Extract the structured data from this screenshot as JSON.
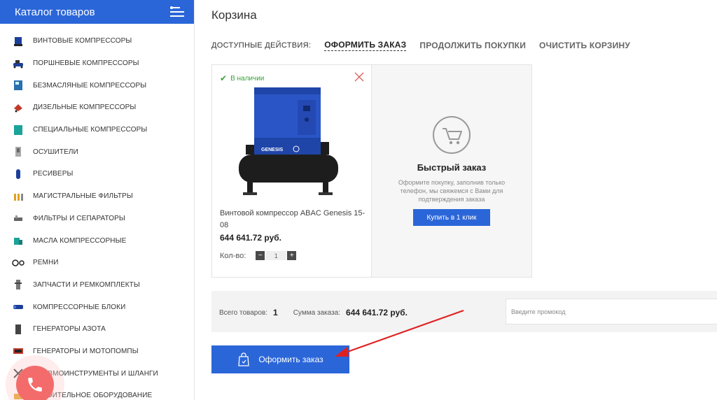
{
  "sidebar": {
    "title": "Каталог товаров",
    "items": [
      {
        "label": "ВИНТОВЫЕ КОМПРЕССОРЫ",
        "icon": "screw-compressor-icon"
      },
      {
        "label": "ПОРШНЕВЫЕ КОМПРЕССОРЫ",
        "icon": "piston-compressor-icon"
      },
      {
        "label": "БЕЗМАСЛЯНЫЕ КОМПРЕССОРЫ",
        "icon": "oilfree-compressor-icon"
      },
      {
        "label": "ДИЗЕЛЬНЫЕ КОМПРЕССОРЫ",
        "icon": "diesel-compressor-icon"
      },
      {
        "label": "СПЕЦИАЛЬНЫЕ КОМПРЕССОРЫ",
        "icon": "special-compressor-icon"
      },
      {
        "label": "ОСУШИТЕЛИ",
        "icon": "dryer-icon"
      },
      {
        "label": "РЕСИВЕРЫ",
        "icon": "receiver-icon"
      },
      {
        "label": "МАГИСТРАЛЬНЫЕ ФИЛЬТРЫ",
        "icon": "line-filter-icon"
      },
      {
        "label": "ФИЛЬТРЫ И СЕПАРАТОРЫ",
        "icon": "separator-icon"
      },
      {
        "label": "МАСЛА КОМПРЕССОРНЫЕ",
        "icon": "oil-icon"
      },
      {
        "label": "РЕМНИ",
        "icon": "belt-icon"
      },
      {
        "label": "ЗАПЧАСТИ И РЕМКОМПЛЕКТЫ",
        "icon": "spare-parts-icon"
      },
      {
        "label": "КОМПРЕССОРНЫЕ БЛОКИ",
        "icon": "compressor-block-icon"
      },
      {
        "label": "ГЕНЕРАТОРЫ АЗОТА",
        "icon": "nitrogen-generator-icon"
      },
      {
        "label": "ГЕНЕРАТОРЫ И МОТОПОМПЫ",
        "icon": "generator-icon"
      },
      {
        "label": "ПНЕВМОИНСТРУМЕНТЫ И ШЛАНГИ",
        "icon": "pneumatic-tool-icon"
      },
      {
        "label": "СТРОИТЕЛЬНОЕ ОБОРУДОВАНИЕ",
        "icon": "construction-icon"
      }
    ]
  },
  "page": {
    "title": "Корзина"
  },
  "actions": {
    "label": "ДОСТУПНЫЕ ДЕЙСТВИЯ:",
    "checkout": "ОФОРМИТЬ ЗАКАЗ",
    "continue": "ПРОДОЛЖИТЬ ПОКУПКИ",
    "clear": "ОЧИСТИТЬ КОРЗИНУ"
  },
  "cart_item": {
    "stock": "В наличии",
    "name": "Винтовой компрессор ABAC Genesis 15-08",
    "price": "644 641.72 руб.",
    "qty_label": "Кол-во:",
    "qty_minus": "−",
    "qty_value": "1",
    "qty_plus": "+",
    "image_brand": "GENESIS"
  },
  "quick_order": {
    "title": "Быстрый заказ",
    "text": "Оформите покупку, заполнив только телефон, мы свяжемся с Вами для подтверждения заказа",
    "button": "Купить в 1 клик"
  },
  "summary": {
    "total_items_label": "Всего товаров:",
    "total_items_value": "1",
    "sum_label": "Сумма заказа:",
    "sum_value": "644 641.72 руб.",
    "promo_placeholder": "Введите промокод"
  },
  "checkout_button": "Оформить заказ",
  "colors": {
    "accent": "#2b66d9",
    "in_stock": "#3aa23a",
    "remove": "#e05a5a",
    "annotation_arrow": "#e02020"
  }
}
